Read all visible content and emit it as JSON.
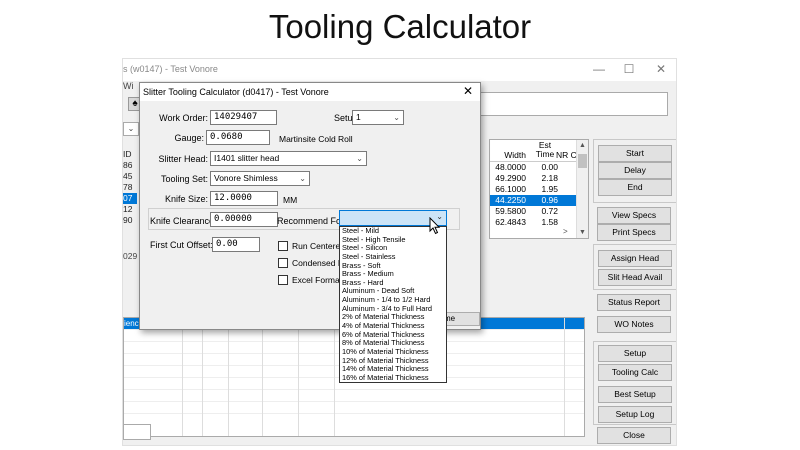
{
  "slide": {
    "title": "Tooling Calculator"
  },
  "main_window": {
    "title": "s (w0147) - Test Vonore",
    "menu_fragment": "Wi",
    "window_controls": {
      "minimize": "—",
      "maximize": "☐",
      "close": "✕"
    },
    "id_column": {
      "header": "ID",
      "rows": [
        "86",
        "45",
        "78",
        "07",
        "12",
        "90"
      ],
      "selected_index": 3
    },
    "fragment_029": "029",
    "grid": {
      "headers": {
        "width": "Width",
        "est_time": "Est\nTime",
        "nr_cut": "NR Cu"
      },
      "rows": [
        {
          "width": "48.0000",
          "time": "0.00"
        },
        {
          "width": "49.2900",
          "time": "2.18"
        },
        {
          "width": "66.1000",
          "time": "1.95"
        },
        {
          "width": "44.2250",
          "time": "0.96"
        },
        {
          "width": "59.5800",
          "time": "0.72"
        },
        {
          "width": "62.4843",
          "time": "1.58"
        }
      ],
      "selected_index": 3
    },
    "buttons": {
      "start": "Start",
      "delay": "Delay",
      "end": "End",
      "view_specs": "View Specs",
      "print_specs": "Print Specs",
      "assign_head": "Assign Head",
      "slit_head_avail": "Slit Head Avail",
      "status_report": "Status Report",
      "wo_notes": "WO Notes",
      "setup": "Setup",
      "tooling_calc": "Tooling Calc",
      "best_setup": "Best Setup",
      "setup_log": "Setup Log",
      "close": "Close"
    },
    "bottom_grid": {
      "selected_fragment": "ienc"
    }
  },
  "dialog": {
    "title": "Slitter Tooling Calculator (d0417) - Test Vonore",
    "close": "✕",
    "work_order": {
      "label": "Work Order:",
      "value": "14029407"
    },
    "setup": {
      "label": "Setup:",
      "value": "1"
    },
    "gauge": {
      "label": "Gauge:",
      "value": "0.0680",
      "note": "Martinsite Cold Roll"
    },
    "slitter_head": {
      "label": "Slitter Head:",
      "value": "I1401 slitter head"
    },
    "tooling_set": {
      "label": "Tooling Set:",
      "value": "Vonore Shimless"
    },
    "knife_size": {
      "label": "Knife Size:",
      "value": "12.0000",
      "unit": "MM"
    },
    "knife_clearance": {
      "label": "Knife Clearance:",
      "value": "0.00000"
    },
    "recommend_for": {
      "label": "Recommend For:",
      "value": ""
    },
    "first_cut_offset": {
      "label": "First Cut Offset:",
      "value": "0.00"
    },
    "checkboxes": {
      "run_centered": "Run Centered",
      "condensed": "Condensed R",
      "excel_format": "Excel Format"
    },
    "bottom_button_fragment": "me",
    "recommend_options": [
      "Steel - Mild",
      "Steel - High Tensile",
      "Steel - Silicon",
      "Steel - Stainless",
      "Brass - Soft",
      "Brass - Medium",
      "Brass - Hard",
      "Aluminum - Dead Soft",
      "Aluminum - 1/4 to 1/2 Hard",
      "Aluminum - 3/4 to Full Hard",
      "2% of Material Thickness",
      "4% of Material Thickness",
      "6% of Material Thickness",
      "8% of Material Thickness",
      "10% of Material Thickness",
      "12% of Material Thickness",
      "14% of Material Thickness",
      "16% of Material Thickness"
    ]
  },
  "colors": {
    "selection": "#0078d7",
    "dialog_bg": "#f0f0f0",
    "combo_focus": "#cce4f7"
  }
}
